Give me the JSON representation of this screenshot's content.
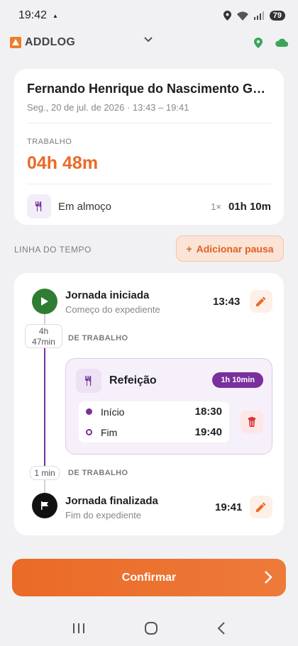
{
  "status_bar": {
    "time": "19:42",
    "battery": "79"
  },
  "app_bar": {
    "app_name": "ADDLOG"
  },
  "summary": {
    "name": "Fernando Henrique do Nascimento Gonçalves",
    "date_range": "Seg., 20 de jul. de 2026 · 13:43 – 19:41",
    "work_label": "TRABALHO",
    "work_hours": "04h 48m",
    "lunch_label": "Em almoço",
    "lunch_count": "1×",
    "lunch_duration": "01h 10m"
  },
  "timeline": {
    "title": "LINHA DO TEMPO",
    "add_pause_label": "Adicionar pausa",
    "start_event": {
      "title": "Jornada iniciada",
      "subtitle": "Começo do expediente",
      "time": "13:43"
    },
    "work_segment_1": {
      "duration_h": "4h",
      "duration_m": "47min",
      "label": "DE TRABALHO"
    },
    "meal": {
      "title": "Refeição",
      "badge": "1h 10min",
      "start_label": "Início",
      "start_time": "18:30",
      "end_label": "Fim",
      "end_time": "19:40"
    },
    "work_segment_2": {
      "duration": "1 min",
      "label": "DE TRABALHO"
    },
    "end_event": {
      "title": "Jornada finalizada",
      "subtitle": "Fim do expediente",
      "time": "19:41"
    }
  },
  "confirm_label": "Confirmar",
  "colors": {
    "accent": "#ea6a26",
    "meal_purple": "#7a2f9c",
    "start_green": "#2e7d32"
  }
}
